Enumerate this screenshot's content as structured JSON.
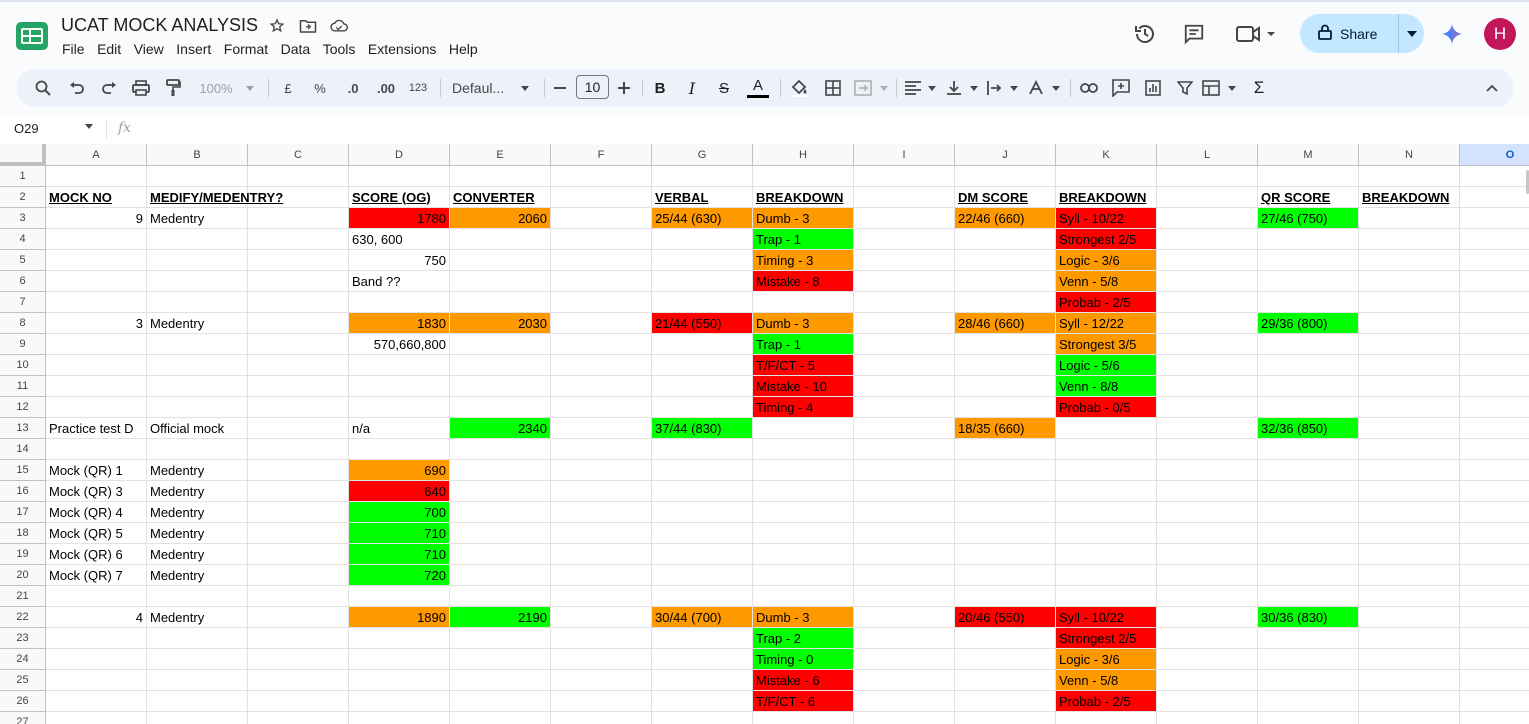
{
  "doc": {
    "title": "UCAT MOCK ANALYSIS",
    "menu": [
      "File",
      "Edit",
      "View",
      "Insert",
      "Format",
      "Data",
      "Tools",
      "Extensions",
      "Help"
    ],
    "share_label": "Share",
    "avatar_initial": "H"
  },
  "toolbar": {
    "zoom": "100%",
    "currency": "£",
    "percent": "%",
    "dec_decrease": ".0",
    "dec_increase": ".00",
    "number_format": "123",
    "font": "Defaul...",
    "font_size": "10",
    "bold": "B",
    "italic": "I",
    "strike": "S",
    "text_color": "A",
    "sum": "Σ"
  },
  "formula_bar": {
    "cell_ref": "O29",
    "fx": "fx"
  },
  "sheet": {
    "columns": [
      "A",
      "B",
      "C",
      "D",
      "E",
      "F",
      "G",
      "H",
      "I",
      "J",
      "K",
      "L",
      "M",
      "N",
      "O"
    ],
    "selected_column": "O",
    "rows": [
      "1",
      "2",
      "3",
      "4",
      "5",
      "6",
      "7",
      "8",
      "9",
      "10",
      "11",
      "12",
      "13",
      "14",
      "15",
      "16",
      "17",
      "18",
      "19",
      "20",
      "21",
      "22",
      "23",
      "24",
      "25",
      "26",
      "27"
    ],
    "cells": [
      {
        "r": 2,
        "c": "A",
        "v": "MOCK NO",
        "bold": true
      },
      {
        "r": 2,
        "c": "B",
        "v": "MEDIFY/MEDENTRY?",
        "bold": true
      },
      {
        "r": 2,
        "c": "D",
        "v": "SCORE (OG)",
        "bold": true
      },
      {
        "r": 2,
        "c": "E",
        "v": "CONVERTER",
        "bold": true
      },
      {
        "r": 2,
        "c": "G",
        "v": "VERBAL",
        "bold": true
      },
      {
        "r": 2,
        "c": "H",
        "v": "BREAKDOWN",
        "bold": true
      },
      {
        "r": 2,
        "c": "J",
        "v": "DM SCORE",
        "bold": true
      },
      {
        "r": 2,
        "c": "K",
        "v": "BREAKDOWN",
        "bold": true
      },
      {
        "r": 2,
        "c": "M",
        "v": "QR SCORE",
        "bold": true
      },
      {
        "r": 2,
        "c": "N",
        "v": "BREAKDOWN",
        "bold": true
      },
      {
        "r": 3,
        "c": "A",
        "v": "9",
        "num": true
      },
      {
        "r": 3,
        "c": "B",
        "v": "Medentry"
      },
      {
        "r": 3,
        "c": "D",
        "v": "1780",
        "num": true,
        "bg": "red"
      },
      {
        "r": 3,
        "c": "E",
        "v": "2060",
        "num": true,
        "bg": "orange"
      },
      {
        "r": 3,
        "c": "G",
        "v": "25/44 (630)",
        "bg": "orange"
      },
      {
        "r": 3,
        "c": "H",
        "v": "Dumb - 3",
        "bg": "orange"
      },
      {
        "r": 3,
        "c": "J",
        "v": "22/46 (660)",
        "bg": "orange"
      },
      {
        "r": 3,
        "c": "K",
        "v": "Syll - 10/22",
        "bg": "red"
      },
      {
        "r": 3,
        "c": "M",
        "v": "27/46 (750)",
        "bg": "green"
      },
      {
        "r": 4,
        "c": "D",
        "v": "630, 600"
      },
      {
        "r": 4,
        "c": "H",
        "v": "Trap - 1",
        "bg": "green"
      },
      {
        "r": 4,
        "c": "K",
        "v": "Strongest 2/5",
        "bg": "red"
      },
      {
        "r": 5,
        "c": "D",
        "v": "750",
        "num": true
      },
      {
        "r": 5,
        "c": "H",
        "v": "Timing - 3",
        "bg": "orange"
      },
      {
        "r": 5,
        "c": "K",
        "v": "Logic - 3/6",
        "bg": "orange"
      },
      {
        "r": 6,
        "c": "D",
        "v": "Band ??"
      },
      {
        "r": 6,
        "c": "H",
        "v": "Mistake - 8",
        "bg": "red"
      },
      {
        "r": 6,
        "c": "K",
        "v": "Venn - 5/8",
        "bg": "orange"
      },
      {
        "r": 7,
        "c": "K",
        "v": "Probab - 2/5",
        "bg": "red"
      },
      {
        "r": 8,
        "c": "A",
        "v": "3",
        "num": true
      },
      {
        "r": 8,
        "c": "B",
        "v": "Medentry"
      },
      {
        "r": 8,
        "c": "D",
        "v": "1830",
        "num": true,
        "bg": "orange"
      },
      {
        "r": 8,
        "c": "E",
        "v": "2030",
        "num": true,
        "bg": "orange"
      },
      {
        "r": 8,
        "c": "G",
        "v": "21/44 (550)",
        "bg": "red"
      },
      {
        "r": 8,
        "c": "H",
        "v": "Dumb - 3",
        "bg": "orange"
      },
      {
        "r": 8,
        "c": "J",
        "v": "28/46 (660)",
        "bg": "orange"
      },
      {
        "r": 8,
        "c": "K",
        "v": "Syll -  12/22",
        "bg": "orange"
      },
      {
        "r": 8,
        "c": "M",
        "v": "29/36 (800)",
        "bg": "green"
      },
      {
        "r": 9,
        "c": "D",
        "v": "570,660,800",
        "num": true
      },
      {
        "r": 9,
        "c": "H",
        "v": "Trap - 1",
        "bg": "green"
      },
      {
        "r": 9,
        "c": "K",
        "v": "Strongest 3/5",
        "bg": "orange"
      },
      {
        "r": 10,
        "c": "H",
        "v": "T/F/CT - 5",
        "bg": "red"
      },
      {
        "r": 10,
        "c": "K",
        "v": "Logic - 5/6",
        "bg": "green"
      },
      {
        "r": 11,
        "c": "H",
        "v": "Mistake - 10",
        "bg": "red"
      },
      {
        "r": 11,
        "c": "K",
        "v": "Venn - 8/8",
        "bg": "green"
      },
      {
        "r": 12,
        "c": "H",
        "v": "Timing - 4",
        "bg": "red"
      },
      {
        "r": 12,
        "c": "K",
        "v": "Probab - 0/5",
        "bg": "red"
      },
      {
        "r": 13,
        "c": "A",
        "v": "Practice test D"
      },
      {
        "r": 13,
        "c": "B",
        "v": "Official mock"
      },
      {
        "r": 13,
        "c": "D",
        "v": "n/a"
      },
      {
        "r": 13,
        "c": "E",
        "v": "2340",
        "num": true,
        "bg": "green"
      },
      {
        "r": 13,
        "c": "G",
        "v": "37/44 (830)",
        "bg": "green"
      },
      {
        "r": 13,
        "c": "J",
        "v": "18/35 (660)",
        "bg": "orange"
      },
      {
        "r": 13,
        "c": "M",
        "v": "32/36 (850)",
        "bg": "green"
      },
      {
        "r": 15,
        "c": "A",
        "v": "Mock (QR) 1"
      },
      {
        "r": 15,
        "c": "B",
        "v": "Medentry"
      },
      {
        "r": 15,
        "c": "D",
        "v": "690",
        "num": true,
        "bg": "orange"
      },
      {
        "r": 16,
        "c": "A",
        "v": "Mock (QR) 3"
      },
      {
        "r": 16,
        "c": "B",
        "v": "Medentry"
      },
      {
        "r": 16,
        "c": "D",
        "v": "640",
        "num": true,
        "bg": "red"
      },
      {
        "r": 17,
        "c": "A",
        "v": "Mock (QR) 4"
      },
      {
        "r": 17,
        "c": "B",
        "v": "Medentry"
      },
      {
        "r": 17,
        "c": "D",
        "v": "700",
        "num": true,
        "bg": "green"
      },
      {
        "r": 18,
        "c": "A",
        "v": "Mock (QR) 5"
      },
      {
        "r": 18,
        "c": "B",
        "v": "Medentry"
      },
      {
        "r": 18,
        "c": "D",
        "v": "710",
        "num": true,
        "bg": "green"
      },
      {
        "r": 19,
        "c": "A",
        "v": "Mock (QR) 6"
      },
      {
        "r": 19,
        "c": "B",
        "v": "Medentry"
      },
      {
        "r": 19,
        "c": "D",
        "v": "710",
        "num": true,
        "bg": "green"
      },
      {
        "r": 20,
        "c": "A",
        "v": "Mock (QR) 7"
      },
      {
        "r": 20,
        "c": "B",
        "v": "Medentry"
      },
      {
        "r": 20,
        "c": "D",
        "v": "720",
        "num": true,
        "bg": "green"
      },
      {
        "r": 22,
        "c": "A",
        "v": "4",
        "num": true
      },
      {
        "r": 22,
        "c": "B",
        "v": "Medentry"
      },
      {
        "r": 22,
        "c": "D",
        "v": "1890",
        "num": true,
        "bg": "orange"
      },
      {
        "r": 22,
        "c": "E",
        "v": "2190",
        "num": true,
        "bg": "green"
      },
      {
        "r": 22,
        "c": "G",
        "v": "30/44 (700)",
        "bg": "orange"
      },
      {
        "r": 22,
        "c": "H",
        "v": "Dumb - 3",
        "bg": "orange"
      },
      {
        "r": 22,
        "c": "J",
        "v": "20/46 (550)",
        "bg": "red"
      },
      {
        "r": 22,
        "c": "K",
        "v": "Syll - 10/22",
        "bg": "red"
      },
      {
        "r": 22,
        "c": "M",
        "v": "30/36 (830)",
        "bg": "green"
      },
      {
        "r": 23,
        "c": "H",
        "v": "Trap - 2",
        "bg": "green"
      },
      {
        "r": 23,
        "c": "K",
        "v": "Strongest 2/5",
        "bg": "red"
      },
      {
        "r": 24,
        "c": "H",
        "v": "Timing - 0",
        "bg": "green"
      },
      {
        "r": 24,
        "c": "K",
        "v": "Logic - 3/6",
        "bg": "orange"
      },
      {
        "r": 25,
        "c": "H",
        "v": "Mistake - 6",
        "bg": "red"
      },
      {
        "r": 25,
        "c": "K",
        "v": "Venn - 5/8",
        "bg": "orange"
      },
      {
        "r": 26,
        "c": "H",
        "v": "T/F/CT - 6",
        "bg": "red"
      },
      {
        "r": 26,
        "c": "K",
        "v": "Probab - 2/5",
        "bg": "red"
      }
    ]
  }
}
